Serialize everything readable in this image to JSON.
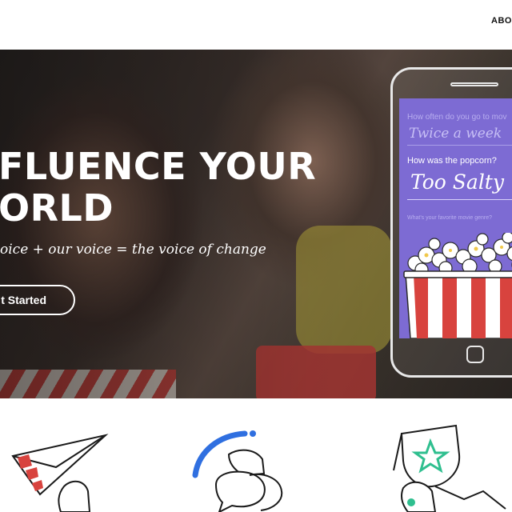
{
  "header": {
    "nav_link": "ABO"
  },
  "hero": {
    "title_line1": "FLUENCE YOUR",
    "title_line2": "ORLD",
    "subtitle": "oice + our voice = the voice of change",
    "cta_label": "t Started"
  },
  "phone": {
    "question1": "How often do you go to mov",
    "answer1": "Twice a week",
    "question2": "How was the popcorn?",
    "answer2": "Too Salty",
    "question3": "What's your favorite movie genre?"
  },
  "features": {
    "icons": [
      "paper-plane-icon",
      "speech-bubble-hand-icon",
      "trophy-star-icon"
    ]
  },
  "colors": {
    "screen_purple": "#7d6bd3",
    "popcorn_red": "#d8433e",
    "accent_blue": "#2f6fe0",
    "accent_green": "#2fbf8f"
  }
}
